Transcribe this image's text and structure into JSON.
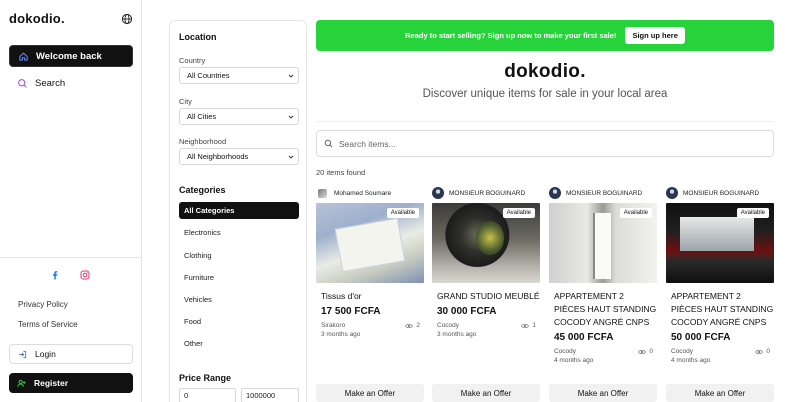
{
  "sidebar": {
    "logo": "dokodio.",
    "nav": [
      {
        "label": "Welcome back",
        "icon": "home-icon",
        "active": true
      },
      {
        "label": "Search",
        "icon": "search-icon",
        "active": false
      }
    ],
    "social": [
      "facebook-icon",
      "instagram-icon"
    ],
    "links": [
      "Privacy Policy",
      "Terms of Service"
    ],
    "login_label": "Login",
    "register_label": "Register"
  },
  "filters": {
    "location_title": "Location",
    "country_label": "Country",
    "country_value": "All Countries",
    "city_label": "City",
    "city_value": "All Cities",
    "neighborhood_label": "Neighborhood",
    "neighborhood_value": "All Neighborhoods",
    "categories_title": "Categories",
    "categories": [
      "All Categories",
      "Electronics",
      "Clothing",
      "Furniture",
      "Vehicles",
      "Food",
      "Other"
    ],
    "price_title": "Price Range",
    "price_min": "0",
    "price_max": "1000000"
  },
  "banner": {
    "text": "Ready to start selling? Sign up now to make your first sale!",
    "button": "Sign up here",
    "color": "#27d33a"
  },
  "hero": {
    "title": "dokodio.",
    "subtitle": "Discover unique items for sale in your local area"
  },
  "search": {
    "placeholder": "Search items..."
  },
  "results": {
    "count_text": "20 items found",
    "items": [
      {
        "seller": "Mohamed Soumare",
        "badge": "Available",
        "title": "Tissus d'or",
        "price": "17 500 FCFA",
        "location": "Sirakoro",
        "time": "3 months ago",
        "views": "2",
        "offer": "Make an Offer"
      },
      {
        "seller": "MONSIEUR BOGUINARD",
        "badge": "Available",
        "title": "GRAND STUDIO MEUBLÉ",
        "price": "30 000 FCFA",
        "location": "Cocody",
        "time": "3 months ago",
        "views": "1",
        "offer": "Make an Offer"
      },
      {
        "seller": "MONSIEUR BOGUINARD",
        "badge": "Available",
        "title": "APPARTEMENT 2 PIÈCES HAUT STANDING COCODY ANGRÉ CNPS",
        "price": "45 000 FCFA",
        "location": "Cocody",
        "time": "4 months ago",
        "views": "0",
        "offer": "Make an Offer"
      },
      {
        "seller": "MONSIEUR BOGUINARD",
        "badge": "Available",
        "title": "APPARTEMENT 2 PIÈCES HAUT STANDING COCODY ANGRÉ CNPS",
        "price": "50 000 FCFA",
        "location": "Cocody",
        "time": "4 months ago",
        "views": "0",
        "offer": "Make an Offer"
      }
    ]
  }
}
